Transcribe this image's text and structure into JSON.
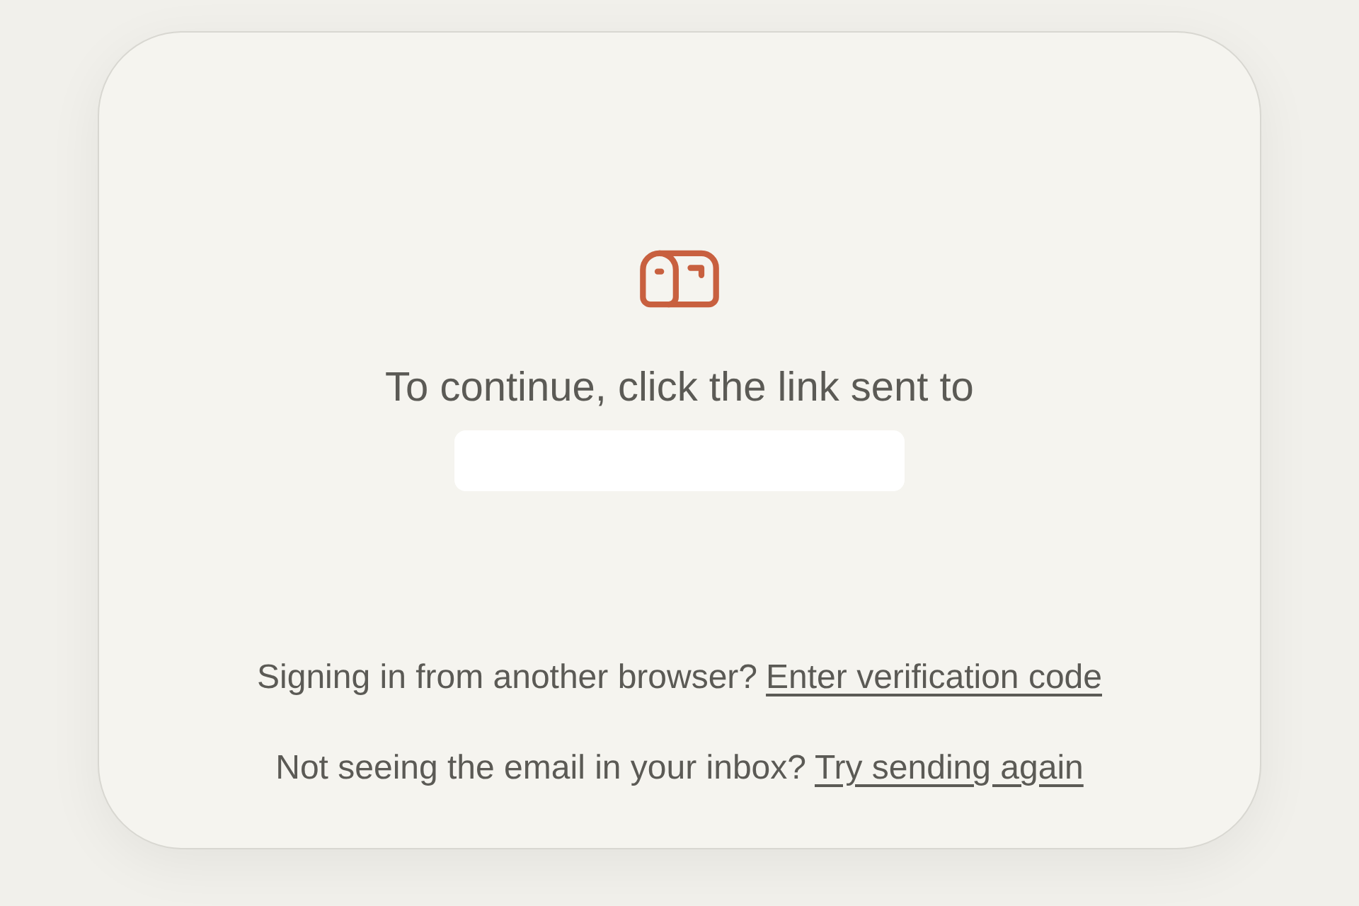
{
  "heading": "To continue, click the link sent to",
  "help_lines": [
    {
      "text": "Signing in from another browser?",
      "link": "Enter verification code"
    },
    {
      "text": "Not seeing the email in your inbox?",
      "link": "Try sending again"
    }
  ]
}
